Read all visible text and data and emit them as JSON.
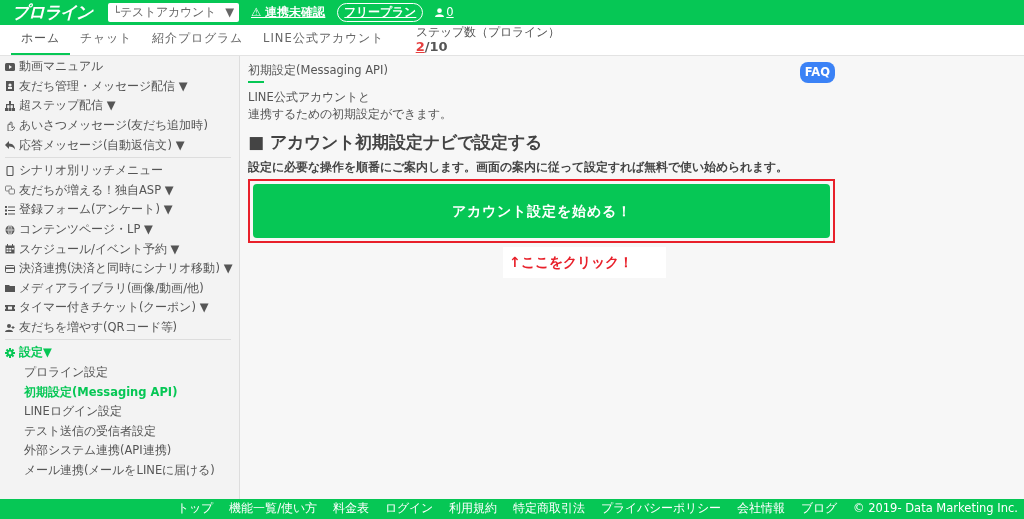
{
  "header": {
    "logo": "プロライン",
    "account_select": {
      "value": "└テストアカウント",
      "caret": "▼"
    },
    "link_warning": {
      "icon": "⚠",
      "text": "連携未確認"
    },
    "plan_badge": "フリープラン",
    "user_count": "0"
  },
  "tabs": [
    {
      "label": "ホーム",
      "selected": true
    },
    {
      "label": "チャット",
      "selected": false
    },
    {
      "label": "紹介プログラム",
      "selected": false
    },
    {
      "label": "LINE公式アカウント",
      "selected": false
    }
  ],
  "step_count": {
    "label": "ステップ数（プロライン）",
    "used": "2",
    "total": "/10"
  },
  "sidebar": {
    "groups": [
      {
        "items": [
          {
            "label": "動画マニュアル"
          },
          {
            "label": "友だち管理・メッセージ配信",
            "arrow": "▼"
          },
          {
            "label": "超ステップ配信",
            "arrow": "▼"
          },
          {
            "label": "あいさつメッセージ",
            "note": "(友だち追加時)"
          },
          {
            "label": "応答メッセージ",
            "note": "(自動返信文)",
            "arrow": "▼"
          }
        ]
      },
      {
        "items": [
          {
            "label": "シナリオ別リッチメニュー"
          },
          {
            "label": "友だちが増える！独自ASP",
            "arrow": "▼"
          },
          {
            "label": "登録フォーム",
            "note": "(アンケート)",
            "arrow": "▼"
          },
          {
            "label": "コンテンツページ・LP",
            "arrow": "▼"
          },
          {
            "label": "スケジュール/イベント予約",
            "arrow": "▼"
          },
          {
            "label": "決済連携",
            "note": "(決済と同時にシナリオ移動)",
            "arrow": "▼"
          },
          {
            "label": "メディアライブラリ",
            "note": "(画像/動画/他)"
          },
          {
            "label": "タイマー付きチケット",
            "note": "(クーポン)",
            "arrow": "▼"
          },
          {
            "label": "友だちを増やす",
            "note": "(QRコード等)"
          }
        ]
      },
      {
        "section": {
          "label": "設定",
          "arrow": "▼",
          "expanded": true
        },
        "children": [
          {
            "label": "プロライン設定",
            "selected": false
          },
          {
            "label": "初期設定",
            "note": "(Messaging API)",
            "selected": true
          },
          {
            "label": "LINEログイン設定",
            "selected": false
          },
          {
            "label": "テスト送信の受信者設定",
            "selected": false
          },
          {
            "label": "外部システム連携",
            "note": "(API連携)",
            "selected": false
          },
          {
            "label": "メール連携",
            "note": "(メールをLINEに届ける)",
            "selected": false
          }
        ]
      }
    ]
  },
  "main": {
    "page_title": "初期設定(Messaging API)",
    "faq": "FAQ",
    "description": [
      "LINE公式アカウントと",
      "連携するための初期設定ができます。"
    ],
    "heading": "■ アカウント初期設定ナビで設定する",
    "subtext": "設定に必要な操作を順番にご案内します。画面の案内に従って設定すれば無料で使い始められます。",
    "start_button": "アカウント設定を始める！",
    "callout": "↑ここをクリック！"
  },
  "footer": {
    "links": [
      "トップ",
      "機能一覧/使い方",
      "料金表",
      "ログイン",
      "利用規約",
      "特定商取引法",
      "プライバシーポリシー",
      "会社情報",
      "ブログ"
    ],
    "copyright": "© 2019- Data Marketing Inc."
  }
}
